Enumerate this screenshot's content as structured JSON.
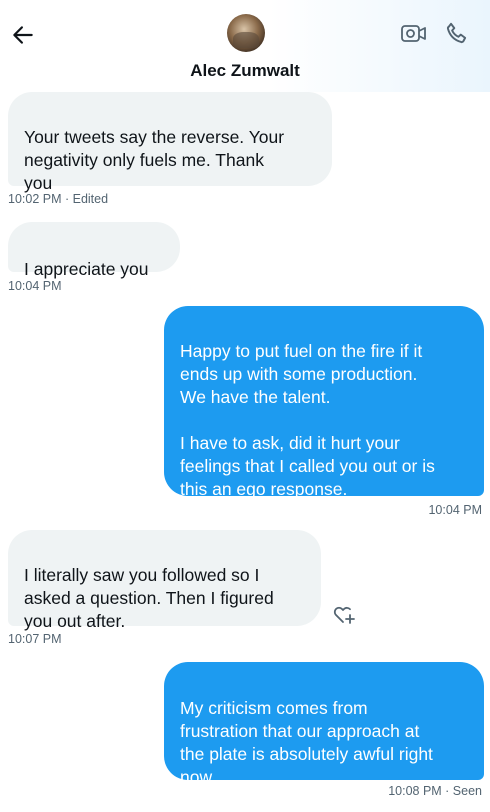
{
  "header": {
    "contact_name": "Alec Zumwalt",
    "back_icon": "arrow-left-icon",
    "video_icon": "video-call-icon",
    "phone_icon": "phone-call-icon"
  },
  "messages": [
    {
      "direction": "in",
      "text": "Your tweets say the reverse. Your\nnegativity only fuels me. Thank\nyou",
      "meta": "10:02 PM · Edited"
    },
    {
      "direction": "in",
      "text": "I appreciate you",
      "meta": "10:04 PM"
    },
    {
      "direction": "out",
      "text": "Happy to put fuel on the fire if it\nends up with some production.\nWe have the talent.\n\nI have to ask, did it hurt your\nfeelings that I called you out or is\nthis an ego response.",
      "meta": "10:04 PM"
    },
    {
      "direction": "in",
      "text": "I literally saw you followed so I\nasked a question. Then I figured\nyou out after.",
      "meta": "10:07 PM"
    },
    {
      "direction": "out",
      "text": "My criticism comes from\nfrustration that our approach at\nthe plate is absolutely awful right\nnow.",
      "meta": "10:08 PM · Seen"
    }
  ],
  "colors": {
    "outgoing_bubble": "#1d9bf0",
    "incoming_bubble": "#eff3f4",
    "meta_text": "#536471"
  }
}
